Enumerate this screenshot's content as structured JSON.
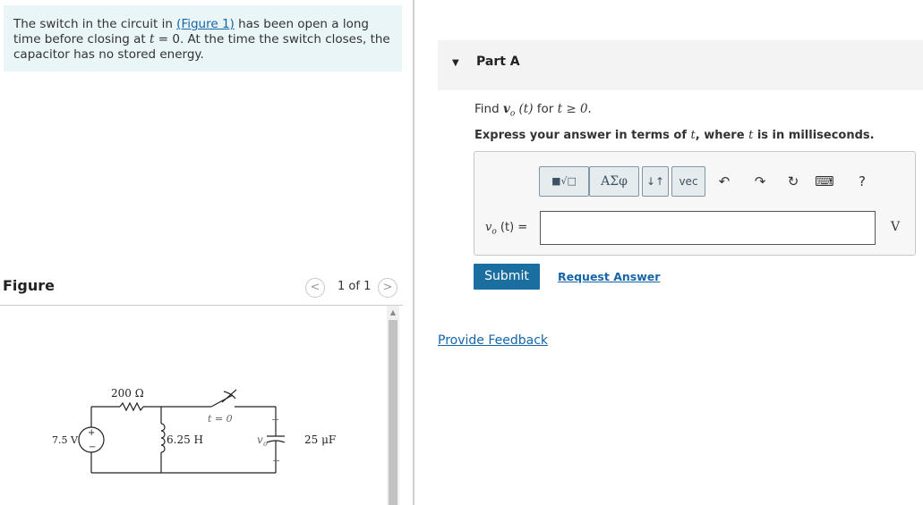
{
  "problem": {
    "text_before_link": "The switch in the circuit in ",
    "figure_link": "(Figure 1)",
    "text_after_link": " has been open a long time before closing at ",
    "t_var": "t",
    "text_after_t": " = 0. At the time the switch closes, the capacitor has no stored energy."
  },
  "figure": {
    "title": "Figure",
    "pager": "1 of 1",
    "prev_glyph": "<",
    "next_glyph": ">",
    "circuit": {
      "source_label": "7.5 V",
      "resistor_label": "200 Ω",
      "inductor_label": "6.25 H",
      "switch_label": "t = 0",
      "capacitor_label": "25 μF",
      "output_label": "v",
      "output_sub": "o",
      "plus": "+",
      "minus": "−"
    }
  },
  "part": {
    "caret": "▼",
    "title": "Part A",
    "question_prefix": "Find ",
    "question_var": "v",
    "question_sub": "o",
    "question_arg": " (t) ",
    "question_mid": "for ",
    "question_cond": "t ≥ 0.",
    "instruction_a": "Express your answer in terms of ",
    "instruction_var": "t",
    "instruction_b": ", where ",
    "instruction_var2": "t",
    "instruction_c": " is in milliseconds."
  },
  "toolbar": {
    "templates": "■√□",
    "greek": "ΑΣφ",
    "arrows": "↓↑",
    "vec": "vec",
    "undo": "↶",
    "redo": "↷",
    "reset": "↻",
    "keyboard": "⌨",
    "help": "?"
  },
  "answer": {
    "label_var": "v",
    "label_sub": "o",
    "label_rest": " (t) =",
    "value": "",
    "unit": "V"
  },
  "actions": {
    "submit": "Submit",
    "request_answer": "Request Answer",
    "provide_feedback": "Provide Feedback"
  },
  "colors": {
    "problem_bg": "#e9f5f6",
    "link": "#1565a8",
    "submit_bg": "#1a6fa0"
  }
}
